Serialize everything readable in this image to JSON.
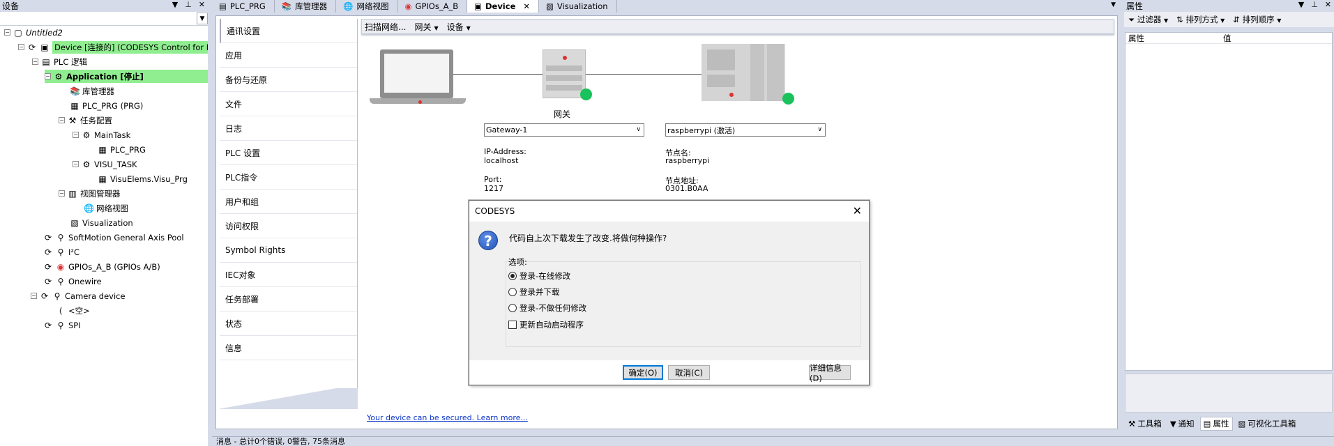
{
  "left_panel": {
    "title": "设备",
    "tree": [
      {
        "label": "Untitled2",
        "italic": true
      },
      {
        "label": "Device [连接的] (CODESYS Control for Raspb",
        "highlight": true
      },
      {
        "label": "PLC 逻辑"
      },
      {
        "label": "Application [停止]",
        "highlight": true,
        "bold": true
      },
      {
        "label": "库管理器"
      },
      {
        "label": "PLC_PRG (PRG)"
      },
      {
        "label": "任务配置"
      },
      {
        "label": "MainTask"
      },
      {
        "label": "PLC_PRG"
      },
      {
        "label": "VISU_TASK"
      },
      {
        "label": "VisuElems.Visu_Prg"
      },
      {
        "label": "视图管理器"
      },
      {
        "label": "网络视图"
      },
      {
        "label": "Visualization"
      },
      {
        "label": "SoftMotion General Axis Pool"
      },
      {
        "label": "I²C"
      },
      {
        "label": "GPIOs_A_B (GPIOs A/B)"
      },
      {
        "label": "Onewire"
      },
      {
        "label": "Camera device"
      },
      {
        "label": "<空>"
      },
      {
        "label": "SPI"
      }
    ]
  },
  "tabs": [
    {
      "label": "PLC_PRG",
      "icon": "document-icon"
    },
    {
      "label": "库管理器",
      "icon": "books-icon"
    },
    {
      "label": "网络视图",
      "icon": "network-icon"
    },
    {
      "label": "GPIOs_A_B",
      "icon": "gpio-icon"
    },
    {
      "label": "Device",
      "icon": "device-icon",
      "active": true,
      "close": "✕"
    },
    {
      "label": "Visualization",
      "icon": "visualization-icon"
    }
  ],
  "device_nav": [
    "通讯设置",
    "应用",
    "备份与还原",
    "文件",
    "日志",
    "PLC 设置",
    "PLC指令",
    "用户和组",
    "访问权限",
    "Symbol Rights",
    "IEC对象",
    "任务部署",
    "状态",
    "信息"
  ],
  "device_toolbar": {
    "scan": "扫描网络...",
    "gateway": "网关",
    "device": "设备"
  },
  "diagram": {
    "gateway_label": "网关",
    "gateway_select": "Gateway-1",
    "device_select": "raspberrypi (激活)",
    "ip_label": "IP-Address:",
    "ip_value": "localhost",
    "port_label": "Port:",
    "port_value": "1217",
    "node_name_label": "节点名:",
    "node_name_value": "raspberrypi",
    "node_addr_label": "节点地址:",
    "node_addr_value": "0301.B0AA",
    "secure_link": "Your device can be secured. Learn more..."
  },
  "dialog": {
    "title": "CODESYS",
    "message": "代码自上次下载发生了改变.将做何种操作?",
    "options_legend": "选项:",
    "options": [
      {
        "label": "登录-在线修改",
        "checked": true
      },
      {
        "label": "登录并下载",
        "checked": false
      },
      {
        "label": "登录-不做任何修改",
        "checked": false
      }
    ],
    "checkbox_label": "更新自动启动程序",
    "ok": "确定(O)",
    "cancel": "取消(C)",
    "details": "详细信息(D)"
  },
  "right_panel": {
    "title": "属性",
    "filter": "过滤器",
    "sort_by": "排列方式",
    "sort_order": "排列顺序",
    "col_property": "属性",
    "col_value": "值",
    "bottom_tabs": [
      "工具箱",
      "通知",
      "属性",
      "可视化工具箱"
    ]
  },
  "status_bar": "消息 - 总计0个错误, 0警告, 75条消息"
}
